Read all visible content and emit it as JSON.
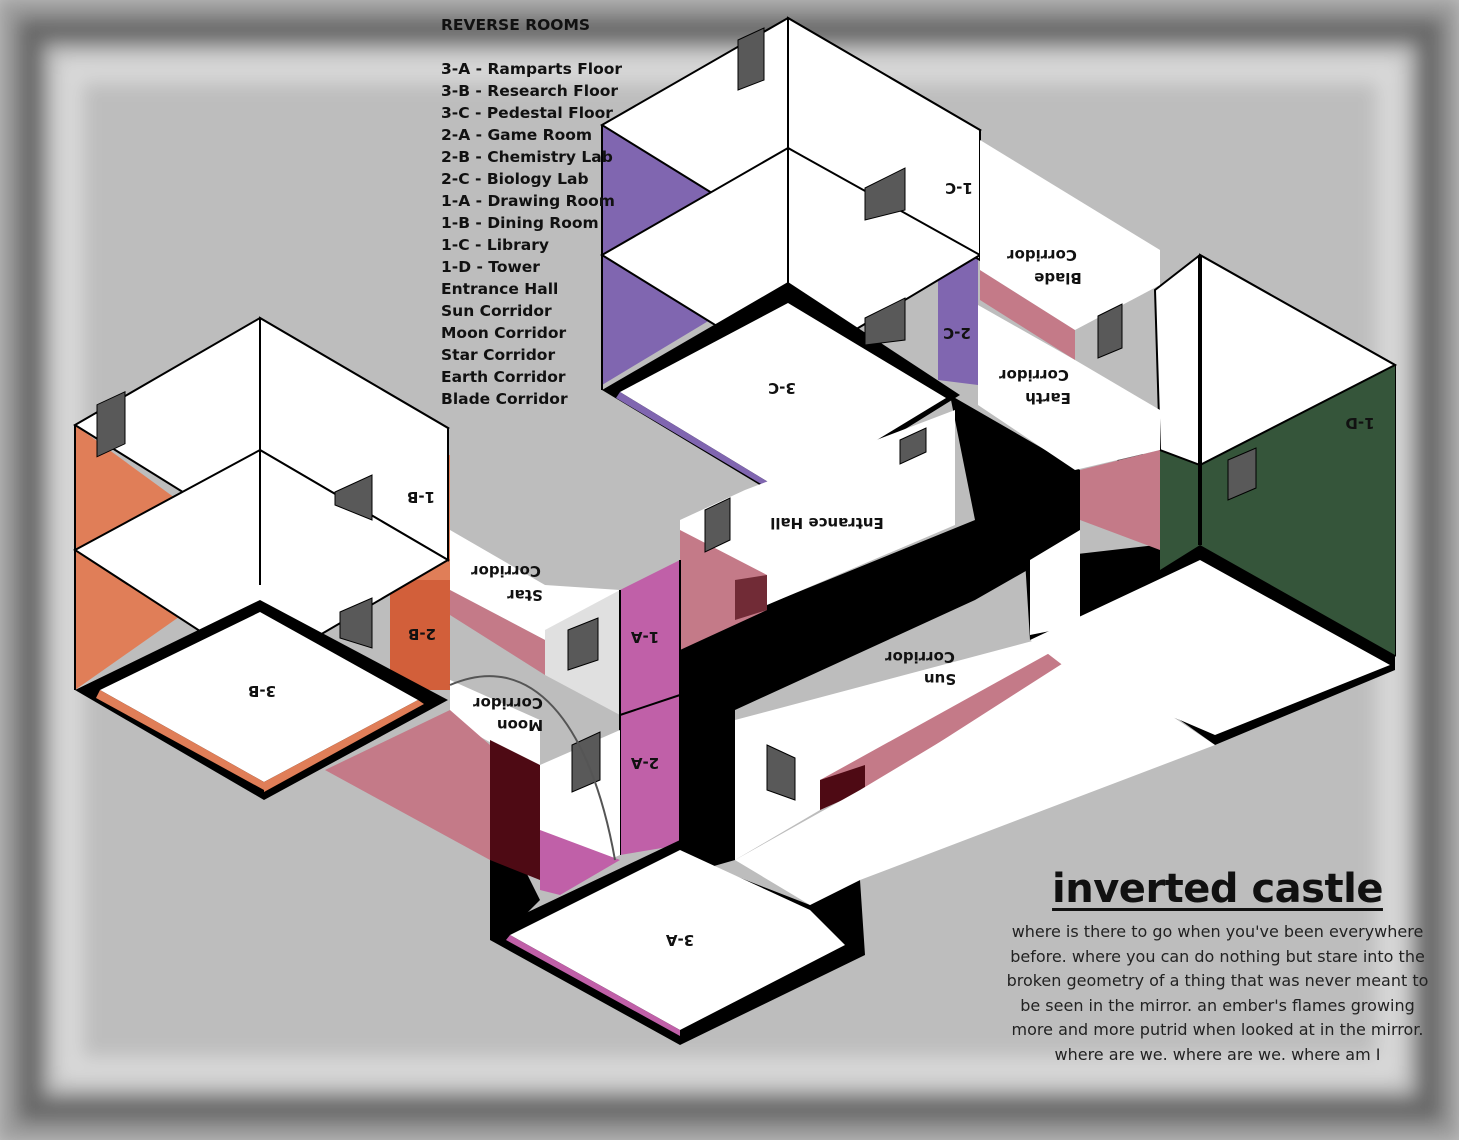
{
  "legend": {
    "heading": "REVERSE ROOMS",
    "items": [
      "3-A - Ramparts Floor",
      "3-B - Research Floor",
      "3-C - Pedestal Floor",
      "2-A - Game Room",
      "2-B - Chemistry Lab",
      "2-C - Biology Lab",
      "1-A - Drawing Room",
      "1-B - Dining Room",
      "1-C - Library",
      "1-D - Tower",
      "Entrance Hall",
      "Sun Corridor",
      "Moon Corridor",
      "Star Corridor",
      "Earth Corridor",
      "Blade Corridor"
    ]
  },
  "map_labels": {
    "r3a": "3-A",
    "r3b": "3-B",
    "r3c": "3-C",
    "r2a": "2-A",
    "r2b": "2-B",
    "r2c": "2-C",
    "r1a": "1-A",
    "r1b": "1-B",
    "r1c": "1-C",
    "r1d": "1-D",
    "entrance": "Entrance Hall",
    "sun_1": "Sun",
    "sun_2": "Corridor",
    "moon_1": "Moon",
    "moon_2": "Corridor",
    "star_1": "Star",
    "star_2": "Corridor",
    "earth_1": "Earth",
    "earth_2": "Corridor",
    "blade_1": "Blade",
    "blade_2": "Corridor"
  },
  "title": {
    "heading": "inverted castle",
    "lines": [
      "where is there to go when you've been everywhere",
      "before. where you can do nothing but stare into the",
      "broken geometry of a thing that was never meant to",
      "be seen in the mirror. an ember's flames growing",
      "more and more putrid when looked at in the mirror.",
      "where are we. where are we. where am I"
    ]
  },
  "colors": {
    "background": "#c2c2c2",
    "orange_rooms": "#e07e58",
    "purple_rooms": "#8066b0",
    "magenta_rooms": "#c060a8",
    "green_tower": "#35553a",
    "corridor_pink": "#c47a88",
    "dark_maroon": "#4e0a14",
    "outline": "#000000"
  }
}
